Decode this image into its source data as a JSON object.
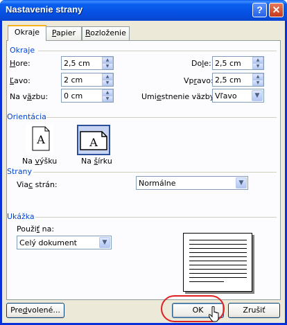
{
  "window": {
    "title": "Nastavenie strany",
    "help_glyph": "?",
    "close_glyph": "✕"
  },
  "tabs": [
    {
      "label_pre": "Okra",
      "label_u": "j",
      "label_post": "e"
    },
    {
      "label_pre": "",
      "label_u": "P",
      "label_post": "apier"
    },
    {
      "label_pre": "",
      "label_u": "R",
      "label_post": "ozloženie"
    }
  ],
  "margins": {
    "section_label": "Okraje",
    "top": {
      "label_u": "H",
      "label_post": "ore:",
      "value": "2,5 cm"
    },
    "left": {
      "label_u": "Ľ",
      "label_post": "avo:",
      "value": "2 cm"
    },
    "gutter": {
      "label_pre": "Na v",
      "label_u": "ä",
      "label_post": "zbu:",
      "value": "0 cm"
    },
    "bottom": {
      "label_pre": "Do",
      "label_u": "l",
      "label_post": "e:",
      "value": "2,5 cm"
    },
    "right": {
      "label_pre": "Vp",
      "label_u": "r",
      "label_post": "avo:",
      "value": "2,5 cm"
    },
    "gutter_position": {
      "label_pre": "Umi",
      "label_u": "e",
      "label_post": "stnenie väzby:",
      "value": "Vľavo"
    }
  },
  "orientation": {
    "section_label": "Orientácia",
    "portrait": {
      "label_pre": "Na ",
      "label_u": "v",
      "label_post": "ýšku",
      "glyph": "A"
    },
    "landscape": {
      "label_pre": "Na ",
      "label_u": "š",
      "label_post": "írku",
      "glyph": "A"
    }
  },
  "pages": {
    "section_label": "Strany",
    "multiple_label_pre": "Via",
    "multiple_label_u": "c",
    "multiple_label_post": " strán:",
    "multiple_value": "Normálne"
  },
  "preview": {
    "section_label": "Ukážka",
    "apply_label_pre": "Použi",
    "apply_label_u": "ť",
    "apply_label_post": " na:",
    "apply_value": "Celý dokument"
  },
  "buttons": {
    "default_pre": "Pre",
    "default_u": "d",
    "default_post": "volené...",
    "ok": "OK",
    "cancel": "Zrušiť"
  },
  "colors": {
    "title_bar": "#0651e4",
    "section_label": "#0046d5",
    "highlight_ring": "#e02020",
    "tab_accent": "#f9b119"
  },
  "icons": [
    "help-icon",
    "close-icon",
    "spin-up-icon",
    "spin-down-icon",
    "dropdown-arrow-icon",
    "portrait-icon",
    "landscape-icon",
    "mouse-cursor-icon"
  ]
}
